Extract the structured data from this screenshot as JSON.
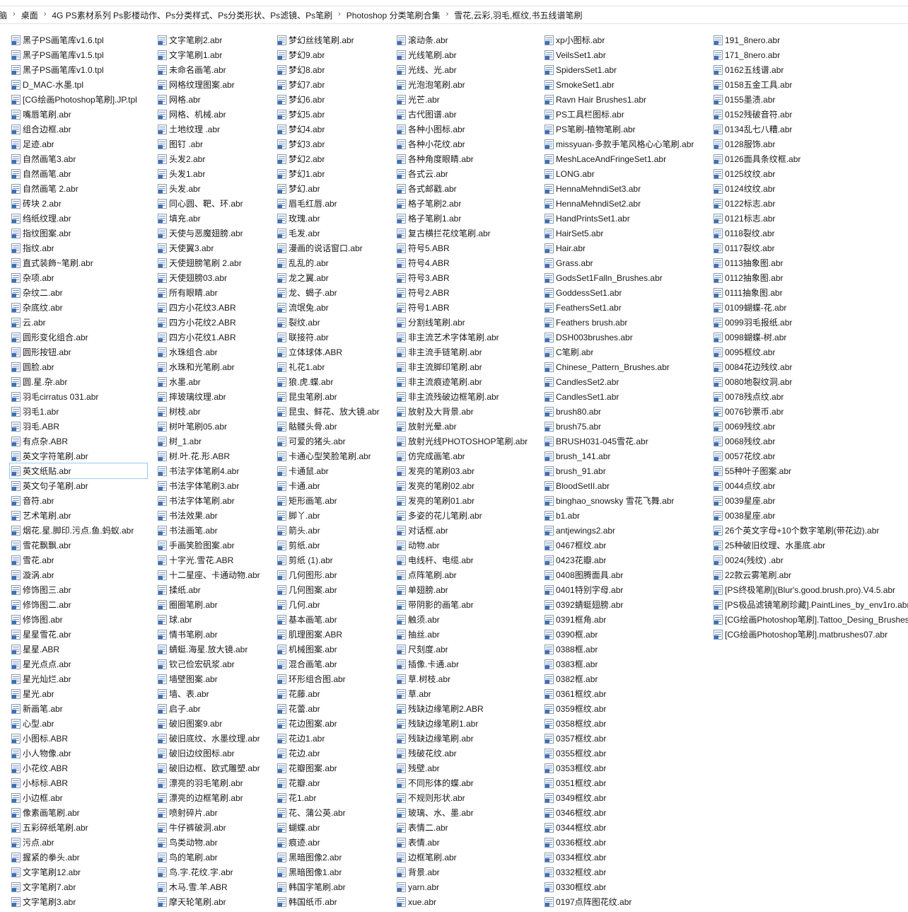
{
  "breadcrumb": [
    "脑",
    "桌面",
    "4G PS素材系列 Ps影楼动作、Ps分类样式、Ps分类形状、Ps滤镜、Ps笔刷",
    "Photoshop 分类笔刷合集",
    "雪花,云彩,羽毛,框纹,书五线谱笔刷"
  ],
  "selected_file": "英文纸贴.abr",
  "columns": [
    [
      "黑子PS画笔库v1.6.tpl",
      "黑子PS画笔库v1.5.tpl",
      "黑子PS画笔库v1.0.tpl",
      "D_MAC-水墨.tpl",
      "[CG绘画Photoshop笔刷].JP.tpl",
      "嘴唇笔刷.abr",
      "组合边框.abr",
      "足迹.abr",
      "自然画笔3.abr",
      "自然画笔.abr",
      "自然画笔 2.abr",
      "砖块 2.abr",
      "绉纸纹理.abr",
      "指纹图案.abr",
      "指纹.abr",
      "直式装飾~笔刷.abr",
      "杂项.abr",
      "杂纹二.abr",
      "杂底纹.abr",
      "云.abr",
      "圆形变化组合.abr",
      "圆形按钮.abr",
      "圆脸.abr",
      "圆.星.杂.abr",
      "羽毛cirratus 031.abr",
      "羽毛1.abr",
      "羽毛.ABR",
      "有点杂.ABR",
      "英文字符笔刷.abr",
      "英文纸贴.abr",
      "英文句子笔刷.abr",
      "音符.abr",
      "艺术笔刷.abr",
      "烟花.星.脚印.污点.鱼.蚂蚁.abr",
      "雪花飘飘.abr",
      "雪花.abr",
      "漩涡.abr",
      "修饰图三.abr",
      "修饰图二.abr",
      "修饰图.abr",
      "星星雪花.abr",
      "星星.ABR",
      "星光点点.abr",
      "星光灿烂.abr",
      "星光.abr",
      "新画笔.abr",
      "心型.abr",
      "小图标.ABR",
      "小人物像.abr",
      "小花纹.ABR",
      "小标标.ABR",
      "小边框.abr",
      "像素画笔刷.abr",
      "五彩碎纸笔刷.abr",
      "污点.abr",
      "握紧的拳头.abr",
      "文字笔刷12.abr",
      "文字笔刷7.abr",
      "文字笔刷3.abr"
    ],
    [
      "文字笔刷2.abr",
      "文字笔刷1.abr",
      "未命名画笔.abr",
      "网格纹理图案.abr",
      "网格.abr",
      "网格、机械.abr",
      "土地纹理 .abr",
      "图钉 .abr",
      "头发2.abr",
      "头发1.abr",
      "头发.abr",
      "同心圆、靶、环.abr",
      "填充.abr",
      "天使与恶魔翅膀.abr",
      "天使翼3.abr",
      "天使翅膀笔刷 2.abr",
      "天使翅膀03.abr",
      "所有眼睛.abr",
      "四方小花纹3.ABR",
      "四方小花纹2.ABR",
      "四方小花纹1.ABR",
      "水珠组合.abr",
      "水珠和光笔刷.abr",
      "水墨.abr",
      "摔玻璃纹理.abr",
      "树枝.abr",
      "树叶笔刷05.abr",
      "树_1.abr",
      "树.叶.花.形.ABR",
      "书法字体笔刷4.abr",
      "书法字体笔刷3.abr",
      "书法字体笔刷.abr",
      "书法效果.abr",
      "书法画笔.abr",
      "手画笑脸图案.abr",
      "十字光.雪花.ABR",
      "十二星座、卡通动物.abr",
      "揉纸.abr",
      "圈圈笔刷.abr",
      "球.abr",
      "情书笔刷.abr",
      "蜻蜓.海星.放大镜.abr",
      "钦己俭宏矾浆.abr",
      "墙壁图案.abr",
      "墙、表.abr",
      "启子.abr",
      "破旧图案9.abr",
      "破旧底纹、水墨纹理.abr",
      "破旧边纹图标.abr",
      "破旧边框、欧式雕塑.abr",
      "漂亮的羽毛笔刷.abr",
      "漂亮的边框笔刷.abr",
      "喷射碎片.abr",
      "牛仔裤破洞.abr",
      "鸟类动物.abr",
      "鸟的笔刷.abr",
      "鸟.字.花纹.字.abr",
      "木马.雪.羊.ABR",
      "摩天轮笔刷.abr"
    ],
    [
      "梦幻丝线笔刷.abr",
      "梦幻9.abr",
      "梦幻8.abr",
      "梦幻7.abr",
      "梦幻6.abr",
      "梦幻5.abr",
      "梦幻4.abr",
      "梦幻3.abr",
      "梦幻2.abr",
      "梦幻1.abr",
      "梦幻.abr",
      "眉毛红唇.abr",
      "玫瑰.abr",
      "毛发.abr",
      "漫画的说话窗口.abr",
      "乱乱的.abr",
      "龙之翼.abr",
      "龙、蝎子.abr",
      "流氓兔.abr",
      "裂纹.abr",
      "联接符.abr",
      "立体球体.ABR",
      "礼花1.abr",
      "狼.虎.蝶.abr",
      "昆虫笔刷.abr",
      "昆虫、鲜花、放大镜.abr",
      "骷髅头骨.abr",
      "可爱的猪头.abr",
      "卡通心型笑脸笔刷.abr",
      "卡通鼠.abr",
      "卡通.abr",
      "矩形画笔.abr",
      "脚丫.abr",
      "箭头.abr",
      "剪纸.abr",
      "剪纸 (1).abr",
      "几何图形.abr",
      "几何图案.abr",
      "几何.abr",
      "基本画笔.abr",
      "肌理图案.ABR",
      "机械图案.abr",
      "混合画笔.abr",
      "环形组合图.abr",
      "花藤.abr",
      "花蕾.abr",
      "花边图案.abr",
      "花边1.abr",
      "花边.abr",
      "花瓣图案.abr",
      "花瓣.abr",
      "花1.abr",
      "花、蒲公英.abr",
      "蝴蝶.abr",
      "痕迹.abr",
      "黑暗图像2.abr",
      "黑暗图像1.abr",
      "韩国字笔刷.abr",
      "韩国纸币.abr"
    ],
    [
      "滚动条.abr",
      "光线笔刷.abr",
      "光线、光.abr",
      "光泡泡笔刷.abr",
      "光芒.abr",
      "古代图谱.abr",
      "各种小图标.abr",
      "各种小花纹.abr",
      "各种角度眼睛.abr",
      "各式云.abr",
      "各式邮戳.abr",
      "格子笔刷2.abr",
      "格子笔刷1.abr",
      "复古横拦花纹笔刷.abr",
      "符号5.ABR",
      "符号4.ABR",
      "符号3.ABR",
      "符号2.ABR",
      "符号1.ABR",
      "分割线笔刷.abr",
      "非主流艺术字体笔刷.abr",
      "非主流手链笔刷.abr",
      "非主流脚印笔刷.abr",
      "非主流痕迹笔刷.abr",
      "非主流残破边框笔刷.abr",
      "放射及大背景.abr",
      "放射光晕.abr",
      "放射光线PHOTOSHOP笔刷.abr",
      "仿完成画笔.abr",
      "发亮的笔刷03.abr",
      "发亮的笔刷02.abr",
      "发亮的笔刷01.abr",
      "多姿的花儿笔刷.abr",
      "对话框.abr",
      "动物.abr",
      "电线杆、电缆.abr",
      "点阵笔刷.abr",
      "单翅膀.abr",
      "带阴影的画笔.abr",
      "触须.abr",
      "抽丝.abr",
      "尺刻度.abr",
      "插像.卡通.abr",
      "草.树枝.abr",
      "草.abr",
      "残缺边缘笔刷2.ABR",
      "残缺边缘笔刷1.abr",
      "残缺边缘笔刷.abr",
      "残破花纹.abr",
      "残壁.abr",
      "不同形体的蝶.abr",
      "不规则形状.abr",
      "玻璃、水、墨.abr",
      "表情二.abr",
      "表情.abr",
      "边框笔刷.abr",
      "背景.abr",
      "yarn.abr",
      "xue.abr"
    ],
    [
      "xp小图标.abr",
      "VeilsSet1.abr",
      "SpidersSet1.abr",
      "SmokeSet1.abr",
      "Ravn Hair Brushes1.abr",
      "PS工具栏图标.abr",
      "PS笔刷-植物笔刷.abr",
      "missyuan-多款手笔风格心心笔刷.abr",
      "MeshLaceAndFringeSet1.abr",
      "LONG.abr",
      "HennaMehndiSet3.abr",
      "HennaMehndiSet2.abr",
      "HandPrintsSet1.abr",
      "HairSet5.abr",
      "Hair.abr",
      "Grass.abr",
      "GodsSet1Falln_Brushes.abr",
      "GoddessSet1.abr",
      "FeathersSet1.abr",
      "Feathers brush.abr",
      "DSH003brushes.abr",
      "C笔刷.abr",
      "Chinese_Pattern_Brushes.abr",
      "CandlesSet2.abr",
      "CandlesSet1.abr",
      "brush80.abr",
      "brush75.abr",
      "BRUSH031-045雪花.abr",
      "brush_141.abr",
      "brush_91.abr",
      "BloodSetII.abr",
      "binghao_snowsky 雪花飞舞.abr",
      "b1.abr",
      "antjewings2.abr",
      "0467框纹.abr",
      "0423花瓣.abr",
      "0408图腾面具.abr",
      "0401特别字母.abr",
      "0392蜻蜓翅膀.abr",
      "0391框角.abr",
      "0390框.abr",
      "0388框.abr",
      "0383框.abr",
      "0382框.abr",
      "0361框纹.abr",
      "0359框纹.abr",
      "0358框纹.abr",
      "0357框纹.abr",
      "0355框纹.abr",
      "0353框纹.abr",
      "0351框纹.abr",
      "0349框纹.abr",
      "0346框纹.abr",
      "0344框纹.abr",
      "0336框纹.abr",
      "0334框纹.abr",
      "0332框纹.abr",
      "0330框纹.abr",
      "0197点阵图花纹.abr"
    ],
    [
      "191_8nero.abr",
      "171_8nero.abr",
      "0162五线谱.abr",
      "0158五金工具.abr",
      "0155墨渍.abr",
      "0152残破音符.abr",
      "0134乱七八糟.abr",
      "0128服饰.abr",
      "0126面具条纹框.abr",
      "0125纹纹.abr",
      "0124纹纹.abr",
      "0122标志.abr",
      "0121标志.abr",
      "0118裂纹.abr",
      "0117裂纹.abr",
      "0113抽象图.abr",
      "0112抽象图.abr",
      "0111抽象图.abr",
      "0109蝴蝶-花.abr",
      "0099羽毛报纸.abr",
      "0098蝴蝶-树.abr",
      "0095框纹.abr",
      "0084花边残纹.abr",
      "0080地裂纹洞.abr",
      "0078残点纹.abr",
      "0076钞票币.abr",
      "0069残纹.abr",
      "0068残纹.abr",
      "0057花纹.abr",
      "55种叶子图案.abr",
      "0044点纹.abr",
      "0039星座.abr",
      "0038星座.abr",
      "26个英文字母+10个数字笔刷(带花边).abr",
      "25种破旧纹理、水墨底.abr",
      "0024(残纹) .abr",
      "22款云雾笔刷.abr",
      "[PS终极笔刷](Blur's.good.brush.pro).V4.5.abr",
      "[PS极品滤镜笔刷珍藏].PaintLines_by_env1ro.abr",
      "[CG绘画Photoshop笔刷].Tattoo_Desing_Brushes.abr",
      "[CG绘画Photoshop笔刷].matbrushes07.abr"
    ]
  ]
}
